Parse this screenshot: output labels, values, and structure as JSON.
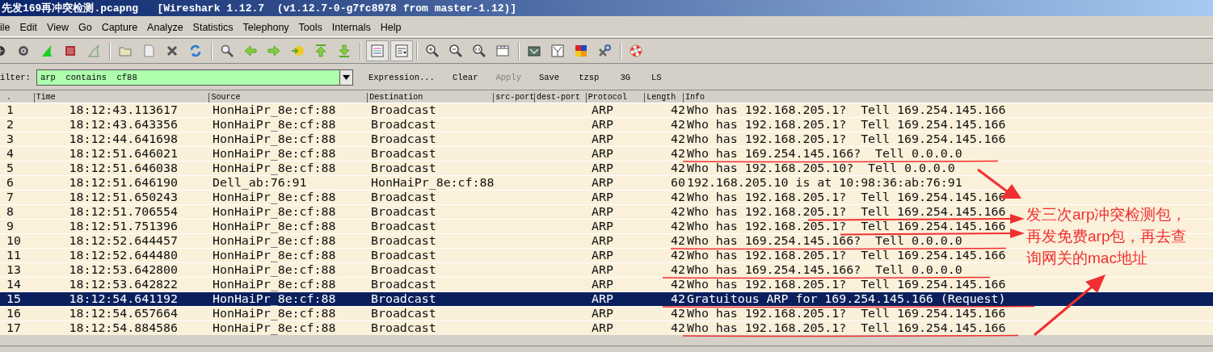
{
  "window": {
    "title": "先发169再冲突检测.pcapng   [Wireshark 1.12.7  (v1.12.7-0-g7fc8978 from master-1.12)]"
  },
  "menu": [
    "ile",
    "Edit",
    "View",
    "Go",
    "Capture",
    "Analyze",
    "Statistics",
    "Telephony",
    "Tools",
    "Internals",
    "Help"
  ],
  "toolbar": {
    "toggles": [
      {
        "on": true
      },
      {
        "on": true
      }
    ]
  },
  "filter": {
    "label": "ilter:",
    "value": "arp  contains  cf88",
    "buttons": [
      {
        "label": "Expression...",
        "disabled": false
      },
      {
        "label": "Clear",
        "disabled": false
      },
      {
        "label": "Apply",
        "disabled": true
      },
      {
        "label": "Save",
        "disabled": false
      },
      {
        "label": "tzsp",
        "disabled": false
      },
      {
        "label": "3G",
        "disabled": false
      },
      {
        "label": "LS",
        "disabled": false
      }
    ]
  },
  "packet_list": {
    "columns": [
      ".",
      "Time",
      "Source",
      "Destination",
      "src-port",
      "dest-port",
      "Protocol",
      "Length",
      "Info"
    ],
    "rows": [
      {
        "no": "1",
        "time": "18:12:43.113617",
        "source": "HonHaiPr_8e:cf:88",
        "destination": "Broadcast",
        "protocol": "ARP",
        "length": "42",
        "info": "Who has 192.168.205.1?  Tell 169.254.145.166",
        "selected": false
      },
      {
        "no": "2",
        "time": "18:12:43.643356",
        "source": "HonHaiPr_8e:cf:88",
        "destination": "Broadcast",
        "protocol": "ARP",
        "length": "42",
        "info": "Who has 192.168.205.1?  Tell 169.254.145.166",
        "selected": false
      },
      {
        "no": "3",
        "time": "18:12:44.641698",
        "source": "HonHaiPr_8e:cf:88",
        "destination": "Broadcast",
        "protocol": "ARP",
        "length": "42",
        "info": "Who has 192.168.205.1?  Tell 169.254.145.166",
        "selected": false
      },
      {
        "no": "4",
        "time": "18:12:51.646021",
        "source": "HonHaiPr_8e:cf:88",
        "destination": "Broadcast",
        "protocol": "ARP",
        "length": "42",
        "info": "Who has 169.254.145.166?  Tell 0.0.0.0",
        "selected": false
      },
      {
        "no": "5",
        "time": "18:12:51.646038",
        "source": "HonHaiPr_8e:cf:88",
        "destination": "Broadcast",
        "protocol": "ARP",
        "length": "42",
        "info": "Who has 192.168.205.10?  Tell 0.0.0.0",
        "selected": false
      },
      {
        "no": "6",
        "time": "18:12:51.646190",
        "source": "Dell_ab:76:91",
        "destination": "HonHaiPr_8e:cf:88",
        "protocol": "ARP",
        "length": "60",
        "info": "192.168.205.10 is at 10:98:36:ab:76:91",
        "selected": false
      },
      {
        "no": "7",
        "time": "18:12:51.650243",
        "source": "HonHaiPr_8e:cf:88",
        "destination": "Broadcast",
        "protocol": "ARP",
        "length": "42",
        "info": "Who has 192.168.205.1?  Tell 169.254.145.166",
        "selected": false
      },
      {
        "no": "8",
        "time": "18:12:51.706554",
        "source": "HonHaiPr_8e:cf:88",
        "destination": "Broadcast",
        "protocol": "ARP",
        "length": "42",
        "info": "Who has 192.168.205.1?  Tell 169.254.145.166",
        "selected": false
      },
      {
        "no": "9",
        "time": "18:12:51.751396",
        "source": "HonHaiPr_8e:cf:88",
        "destination": "Broadcast",
        "protocol": "ARP",
        "length": "42",
        "info": "Who has 192.168.205.1?  Tell 169.254.145.166",
        "selected": false
      },
      {
        "no": "10",
        "time": "18:12:52.644457",
        "source": "HonHaiPr_8e:cf:88",
        "destination": "Broadcast",
        "protocol": "ARP",
        "length": "42",
        "info": "Who has 169.254.145.166?  Tell 0.0.0.0",
        "selected": false
      },
      {
        "no": "11",
        "time": "18:12:52.644480",
        "source": "HonHaiPr_8e:cf:88",
        "destination": "Broadcast",
        "protocol": "ARP",
        "length": "42",
        "info": "Who has 192.168.205.1?  Tell 169.254.145.166",
        "selected": false
      },
      {
        "no": "13",
        "time": "18:12:53.642800",
        "source": "HonHaiPr_8e:cf:88",
        "destination": "Broadcast",
        "protocol": "ARP",
        "length": "42",
        "info": "Who has 169.254.145.166?  Tell 0.0.0.0",
        "selected": false
      },
      {
        "no": "14",
        "time": "18:12:53.642822",
        "source": "HonHaiPr_8e:cf:88",
        "destination": "Broadcast",
        "protocol": "ARP",
        "length": "42",
        "info": "Who has 192.168.205.1?  Tell 169.254.145.166",
        "selected": false
      },
      {
        "no": "15",
        "time": "18:12:54.641192",
        "source": "HonHaiPr_8e:cf:88",
        "destination": "Broadcast",
        "protocol": "ARP",
        "length": "42",
        "info": "Gratuitous ARP for 169.254.145.166 (Request)",
        "selected": true
      },
      {
        "no": "16",
        "time": "18:12:54.657664",
        "source": "HonHaiPr_8e:cf:88",
        "destination": "Broadcast",
        "protocol": "ARP",
        "length": "42",
        "info": "Who has 192.168.205.1?  Tell 169.254.145.166",
        "selected": false
      },
      {
        "no": "17",
        "time": "18:12:54.884586",
        "source": "HonHaiPr_8e:cf:88",
        "destination": "Broadcast",
        "protocol": "ARP",
        "length": "42",
        "info": "Who has 192.168.205.1?  Tell 169.254.145.166",
        "selected": false
      }
    ]
  },
  "annotation": {
    "lines": [
      "发三次arp冲突检测包，",
      "再发免费arp包，再去查",
      "询网关的mac地址"
    ]
  }
}
